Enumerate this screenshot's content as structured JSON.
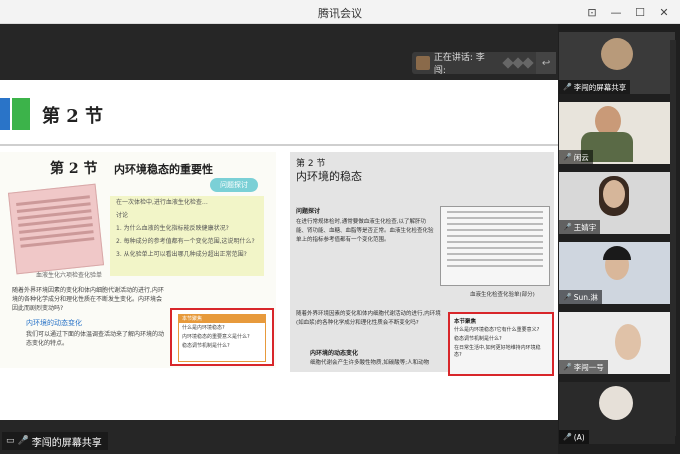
{
  "window": {
    "title": "腾讯会议"
  },
  "window_controls": {
    "pin": "⊡",
    "minimize": "—",
    "maximize": "☐",
    "close": "✕"
  },
  "speaking": {
    "text": "正在讲话: 李闯:"
  },
  "slide": {
    "section_title": "第 2 节",
    "left_page": {
      "title": "第 2 节",
      "subtitle": "内环境稳态的重要性",
      "badge": "问题探讨",
      "sheet_caption": "血液生化六项检查化验单",
      "discussion": [
        "在一次体检中,进行血液生化检查…",
        "讨论",
        "1. 为什么血液的生化指标能反映健康状况?",
        "2. 每种成分的参考值都有一个变化范围,这说明什么?",
        "3. 从化验单上可以看出哪几种成分超出正常范围?"
      ],
      "text": "随着外界环境因素的变化和体内细胞代谢活动的进行,内环境的各种化学成分和理化性质在不断发生变化。内环境会因此而剧烈变动吗?",
      "link": "内环境的动态变化",
      "text2": "我们可以通过下面的体温调查活动来了解内环境的动态变化的特点。",
      "box_header": "本节聚焦",
      "box_items": [
        "什么是内环境稳态?",
        "内环境稳态的重要意义是什么?",
        "稳态调节机制是什么?"
      ]
    },
    "right_page": {
      "section": "第 2 节",
      "title": "内环境的稳态",
      "tag": "问题探讨",
      "text": "在进行常规体检时,通常要做血液生化检查,以了解肝功能、肾功能、血糖、血脂等是否正常。血液生化检查化验单上的指标参考值都有一个变化范围。",
      "caption": "血液生化检查化验单(部分)",
      "text2": "随着外界环境因素的变化和体内细胞代谢活动的进行,内环境(如血浆)的各种化学成分和理化性质会不断变化吗?",
      "sub": "内环境的动态变化",
      "text3": "细胞代谢会产生许多酸性物质,如碳酸等;人和动物",
      "box_header": "本节聚焦",
      "box_items": [
        "什么是内环境稳态?它有什么重要意义?",
        "稳态调节机制是什么?",
        "在日常生活中,如何更好地维持内环境稳态?"
      ]
    }
  },
  "share_label": "李闯的屏幕共享",
  "participants": [
    {
      "name": "李闯的屏幕共享"
    },
    {
      "name": "闲云"
    },
    {
      "name": "王婧宇"
    },
    {
      "name": "Sun.淋"
    },
    {
      "name": "李闯一号"
    },
    {
      "name": "(A)"
    }
  ]
}
